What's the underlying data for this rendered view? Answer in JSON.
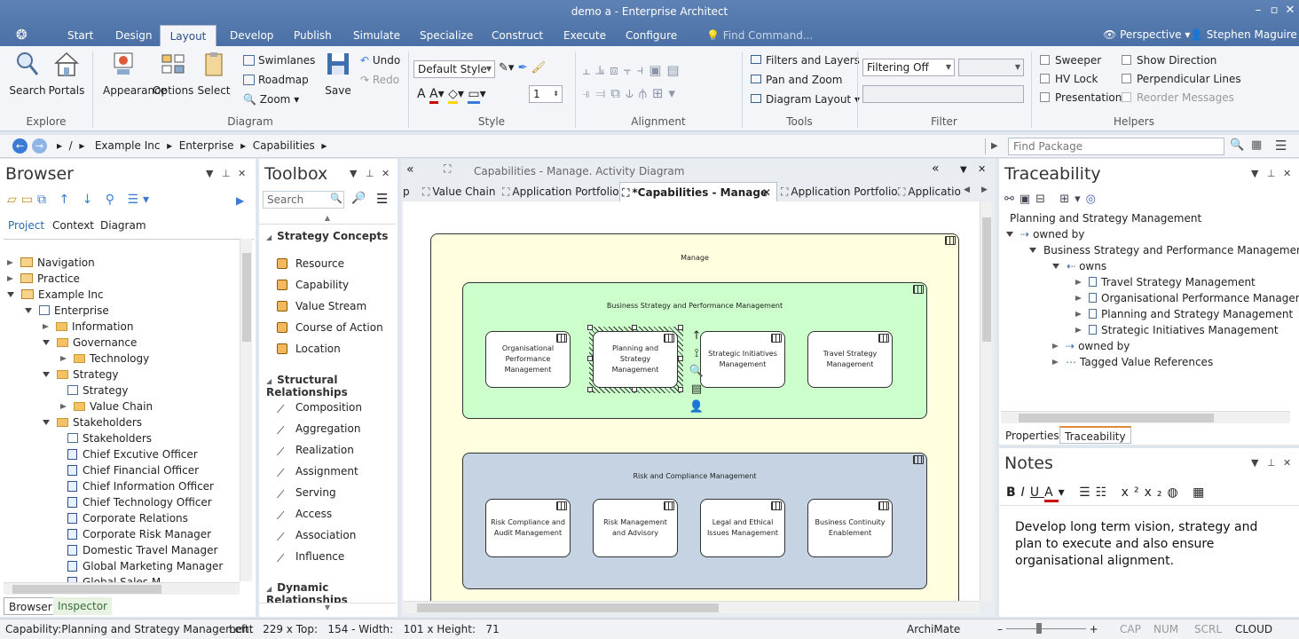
{
  "app": {
    "title": "demo a - Enterprise Architect",
    "user": "Stephen Maguire",
    "perspective": "Perspective",
    "find_command": "Find Command..."
  },
  "ribbon_tabs": [
    "Start",
    "Design",
    "Layout",
    "Develop",
    "Publish",
    "Simulate",
    "Specialize",
    "Construct",
    "Execute",
    "Configure"
  ],
  "ribbon": {
    "explore": {
      "label": "Explore",
      "search": "Search",
      "portals": "Portals"
    },
    "diagram": {
      "label": "Diagram",
      "appearance": "Appearance",
      "options": "Options",
      "select": "Select",
      "swimlanes": "Swimlanes",
      "roadmap": "Roadmap",
      "zoom": "Zoom",
      "save": "Save",
      "undo": "Undo",
      "redo": "Redo"
    },
    "style": {
      "label": "Style",
      "style_value": "Default Style",
      "line_width": "1"
    },
    "alignment": {
      "label": "Alignment"
    },
    "tools": {
      "label": "Tools",
      "filters": "Filters and Layers",
      "pan": "Pan and Zoom",
      "layout": "Diagram Layout"
    },
    "filter": {
      "label": "Filter",
      "value": "Filtering Off"
    },
    "helpers": {
      "label": "Helpers",
      "sweeper": "Sweeper",
      "hv_lock": "HV Lock",
      "presentation": "Presentation",
      "show_direction": "Show Direction",
      "perpendicular": "Perpendicular Lines",
      "reorder": "Reorder Messages"
    }
  },
  "nav": {
    "root": "/",
    "crumbs": [
      "Example Inc",
      "Enterprise",
      "Capabilities"
    ],
    "find_placeholder": "Find Package"
  },
  "browser": {
    "title": "Browser",
    "tabs": [
      "Project",
      "Context",
      "Diagram"
    ],
    "bottom_tabs": [
      "Browser",
      "Inspector"
    ],
    "tree": [
      {
        "label": "Navigation",
        "level": 0,
        "tw": "c",
        "icon": "pkg"
      },
      {
        "label": "Practice",
        "level": 0,
        "tw": "c",
        "icon": "pkg"
      },
      {
        "label": "Example Inc",
        "level": 0,
        "tw": "o",
        "icon": "pkg"
      },
      {
        "label": "Enterprise",
        "level": 1,
        "tw": "o",
        "icon": "diag"
      },
      {
        "label": "Information",
        "level": 2,
        "tw": "c",
        "icon": "fold"
      },
      {
        "label": "Governance",
        "level": 2,
        "tw": "o",
        "icon": "fold"
      },
      {
        "label": "Technology",
        "level": 3,
        "tw": "c",
        "icon": "fold"
      },
      {
        "label": "Strategy",
        "level": 2,
        "tw": "o",
        "icon": "fold"
      },
      {
        "label": "Strategy",
        "level": 3,
        "tw": "",
        "icon": "diag"
      },
      {
        "label": "Value Chain",
        "level": 3,
        "tw": "c",
        "icon": "fold"
      },
      {
        "label": "Stakeholders",
        "level": 2,
        "tw": "o",
        "icon": "fold"
      },
      {
        "label": "Stakeholders",
        "level": 3,
        "tw": "",
        "icon": "diag"
      },
      {
        "label": "Chief Excutive Officer",
        "level": 3,
        "tw": "",
        "icon": "role"
      },
      {
        "label": "Chief Financial Officer",
        "level": 3,
        "tw": "",
        "icon": "role"
      },
      {
        "label": "Chief Information Officer",
        "level": 3,
        "tw": "",
        "icon": "role"
      },
      {
        "label": "Chief Technology Officer",
        "level": 3,
        "tw": "",
        "icon": "role"
      },
      {
        "label": "Corporate Relations",
        "level": 3,
        "tw": "",
        "icon": "role"
      },
      {
        "label": "Corporate Risk Manager",
        "level": 3,
        "tw": "",
        "icon": "role"
      },
      {
        "label": "Domestic Travel Manager",
        "level": 3,
        "tw": "",
        "icon": "role"
      },
      {
        "label": "Global Marketing Manager",
        "level": 3,
        "tw": "",
        "icon": "role"
      },
      {
        "label": "Global Sales M...",
        "level": 3,
        "tw": "",
        "icon": "role"
      }
    ]
  },
  "toolbox": {
    "title": "Toolbox",
    "search_placeholder": "Search",
    "sections": [
      {
        "title": "Strategy Concepts",
        "items": [
          "Resource",
          "Capability",
          "Value Stream",
          "Course of Action",
          "Location"
        ]
      },
      {
        "title": "Structural Relationships",
        "items": [
          "Composition",
          "Aggregation",
          "Realization",
          "Assignment",
          "Serving",
          "Access",
          "Association",
          "Influence"
        ]
      },
      {
        "title": "Dynamic Relationships",
        "items": []
      }
    ]
  },
  "diagram": {
    "header": "Capabilities - Manage.  Activity Diagram",
    "tabs": [
      "p",
      "Value Chain",
      "Application Portfolio",
      "*Capabilities - Manage",
      "Application Portfolio",
      "Applicatio"
    ],
    "active_tab": 3,
    "manage": "Manage",
    "groups": [
      {
        "title": "Business Strategy and Performance Management",
        "elements": [
          "Organisational Performance Management",
          "Planning and Strategy Management",
          "Strategic Initiatives Management",
          "Travel Strategy Management"
        ]
      },
      {
        "title": "Risk and Compliance Management",
        "elements": [
          "Risk Compliance and Audit Management",
          "Risk Management and Advisory",
          "Legal and Ethical Issues Management",
          "Business Continuity Enablement"
        ]
      }
    ]
  },
  "traceability": {
    "title": "Traceability",
    "tabs": [
      "Properties",
      "Traceability"
    ],
    "tree": [
      {
        "label": "Planning and Strategy Management",
        "level": 0,
        "tw": ""
      },
      {
        "label": "owned by",
        "level": 0,
        "tw": "o"
      },
      {
        "label": "Business Strategy and Performance Management",
        "level": 1,
        "tw": "o"
      },
      {
        "label": "owns",
        "level": 2,
        "tw": "o"
      },
      {
        "label": "Travel Strategy Management",
        "level": 3,
        "tw": "c"
      },
      {
        "label": "Organisational Performance Management",
        "level": 3,
        "tw": "c"
      },
      {
        "label": "Planning and Strategy Management",
        "level": 3,
        "tw": "c"
      },
      {
        "label": "Strategic Initiatives Management",
        "level": 3,
        "tw": "c"
      },
      {
        "label": "owned by",
        "level": 2,
        "tw": "c"
      },
      {
        "label": "Tagged Value References",
        "level": 2,
        "tw": "c"
      }
    ]
  },
  "notes": {
    "title": "Notes",
    "text": "Develop long term vision, strategy and plan to execute and also ensure organisational alignment."
  },
  "status": {
    "element": "Capability:Planning and Strategy Management",
    "pos": "Left:   229 x Top:   154 - Width:   101 x Height:   71",
    "tech": "ArchiMate",
    "cap": "CAP",
    "num": "NUM",
    "scrl": "SCRL",
    "cloud": "CLOUD"
  },
  "colors": {
    "title_bar": "#4f74a8",
    "group_green": "#ccffcc",
    "group_blue": "#c5d3e2",
    "manage_bg": "#ffffe0"
  }
}
